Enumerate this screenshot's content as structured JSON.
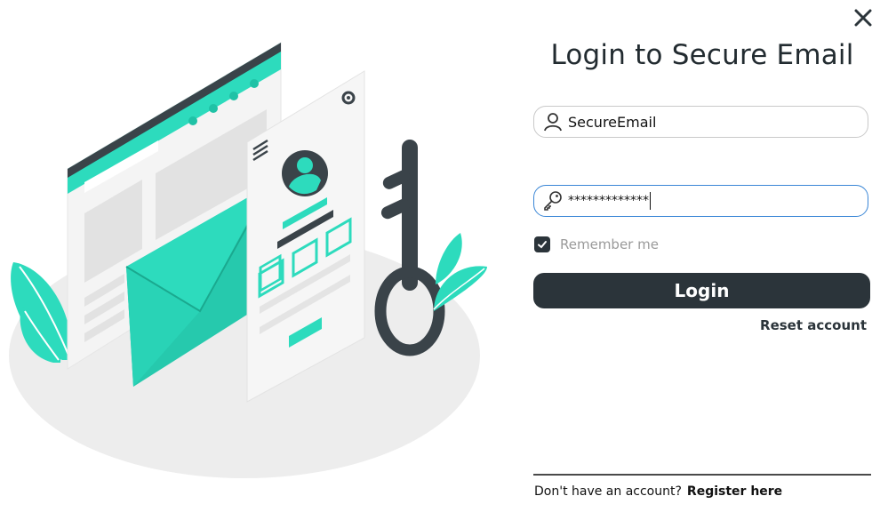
{
  "window": {
    "title": "Login to Secure Email"
  },
  "form": {
    "username": {
      "value": "SecureEmail",
      "icon": "user-icon"
    },
    "password": {
      "value": "*************",
      "icon": "key-icon"
    },
    "remember_me": {
      "label": "Remember me",
      "checked": true
    },
    "login_label": "Login",
    "reset_label": "Reset account"
  },
  "footer": {
    "prompt": "Don't have an account?",
    "register_label": "Register here"
  },
  "illustration": {
    "name": "secure-email-illustration"
  },
  "colors": {
    "accent": "#2ddbbd",
    "dark": "#2b343a",
    "focus_border": "#3a86d6"
  }
}
